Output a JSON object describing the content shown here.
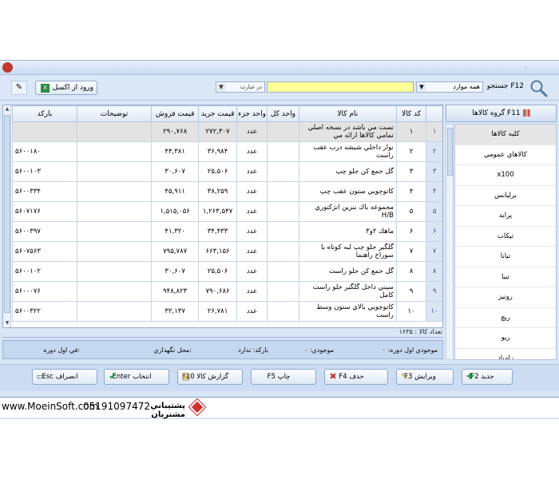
{
  "window": {
    "title": "."
  },
  "search": {
    "excel_button": "ورود از اکسل",
    "excel_icon": "X",
    "combo_filter": "در عبارت",
    "combo_scope": "همه موارد",
    "label": "جستجو F12",
    "placeholder": ""
  },
  "table": {
    "columns": [
      "بارکد",
      "توضیحات",
      "قیمت فروش",
      "قیمت خرید",
      "واحد جزء",
      "واحد کل",
      "نام کالا",
      "کد کالا"
    ],
    "rows": [
      {
        "row": "۱",
        "code": "۱",
        "name": "تست مي باشد در نسخه اصلي تمامي كالاها ارائه مي",
        "unit": "عدد",
        "buy": "۲۷۲,۳۰۷",
        "sell": "۲۹۰,۷۶۸",
        "barcode": "",
        "selected": true
      },
      {
        "row": "۲",
        "code": "۲",
        "name": "نوار داخلي شيشه درب عقب راست",
        "unit": "عدد",
        "buy": "۳۶,۹۸۴",
        "sell": "۴۴,۳۸۱",
        "barcode": "۵۶۰۰۱۸۰"
      },
      {
        "row": "۳",
        "code": "۳",
        "name": "گل جمع كن جلو چپ",
        "unit": "عدد",
        "buy": "۲۵,۵۰۶",
        "sell": "۳۰,۶۰۷",
        "barcode": "۵۶۰۰۱۰۳"
      },
      {
        "row": "۴",
        "code": "۴",
        "name": "كاتوچويي ستون عقب چپ",
        "unit": "عدد",
        "buy": "۳۸,۲۵۹",
        "sell": "۴۵,۹۱۱",
        "barcode": "۵۶۰۰۳۳۴"
      },
      {
        "row": "۵",
        "code": "۵",
        "name": "مجموعه باك بنزين انژكتوري H/B",
        "unit": "عدد",
        "buy": "۱,۲۶۳,۵۴۷",
        "sell": "۱,۵۱۵,۰۵۶",
        "barcode": "۵۶۰۷۱۷۶"
      },
      {
        "row": "۶",
        "code": "۶",
        "name": "ماهك ۲و۳",
        "unit": "عدد",
        "buy": "۳۴,۴۳۳",
        "sell": "۴۱,۳۲۰",
        "barcode": "۵۶۰۰۳۹۷"
      },
      {
        "row": "۷",
        "code": "۷",
        "name": "گلگير جلو چپ لبه كوتاه با سوراخ راهنما",
        "unit": "عدد",
        "buy": "۶۶۳,۱۵۶",
        "sell": "۷۹۵,۷۸۷",
        "barcode": "۵۶۰۷۵۶۳"
      },
      {
        "row": "۸",
        "code": "۸",
        "name": "گل جمع كن جلو راست",
        "unit": "عدد",
        "buy": "۲۵,۵۰۶",
        "sell": "۳۰,۶۰۷",
        "barcode": "۵۶۰۰۱۰۲"
      },
      {
        "row": "۹",
        "code": "۹",
        "name": "سيني داخل گلگير جلو راست كامل",
        "unit": "عدد",
        "buy": "۷۹۰,۶۸۶",
        "sell": "۹۴۸,۸۲۳",
        "barcode": "۵۶۰۰۰۷۶"
      },
      {
        "row": "۱۰",
        "code": "۱۰",
        "name": "كاتوچويي بالاي ستون وسط راست",
        "unit": "عدد",
        "buy": "۲۶,۷۸۱",
        "sell": "۳۲,۱۳۷",
        "barcode": "۵۶۰۰۳۲۲"
      }
    ]
  },
  "count_text": "تعداد كالا : ۱۶۳۵",
  "info": {
    "first_stock": "موجودي اول دوره: ۰",
    "stock": "موجودي: ۰",
    "barcode": "بارکد: ندارد",
    "location": "محل نگهداري:",
    "first_price": "في اول دوره:"
  },
  "groups": {
    "header": "گروه كالاها F11",
    "items": [
      "كليه كالاها",
      "كالاهاي عمومي",
      "x100",
      "برليانس",
      "پرايد",
      "تيكاب",
      "تيانا",
      "تيبا",
      "رونيز",
      "ريچ",
      "ريو",
      "زامياد"
    ]
  },
  "buttons": {
    "new": "جديد F2",
    "edit": "ويرايش F3",
    "delete": "حذف F4",
    "print": "چاپ F5",
    "report": "گزارش كالا F10",
    "select": "انتخاب Enter",
    "cancel": "انصراف Esc"
  },
  "footer": {
    "site": "www.MoeinSoft.com",
    "phone": "05191097472",
    "label": "پشتيباني مشتريان"
  },
  "colors": {
    "search_bg": "#ffff99",
    "window_bg": "#d8e6f6",
    "logo": "#d0312d"
  }
}
